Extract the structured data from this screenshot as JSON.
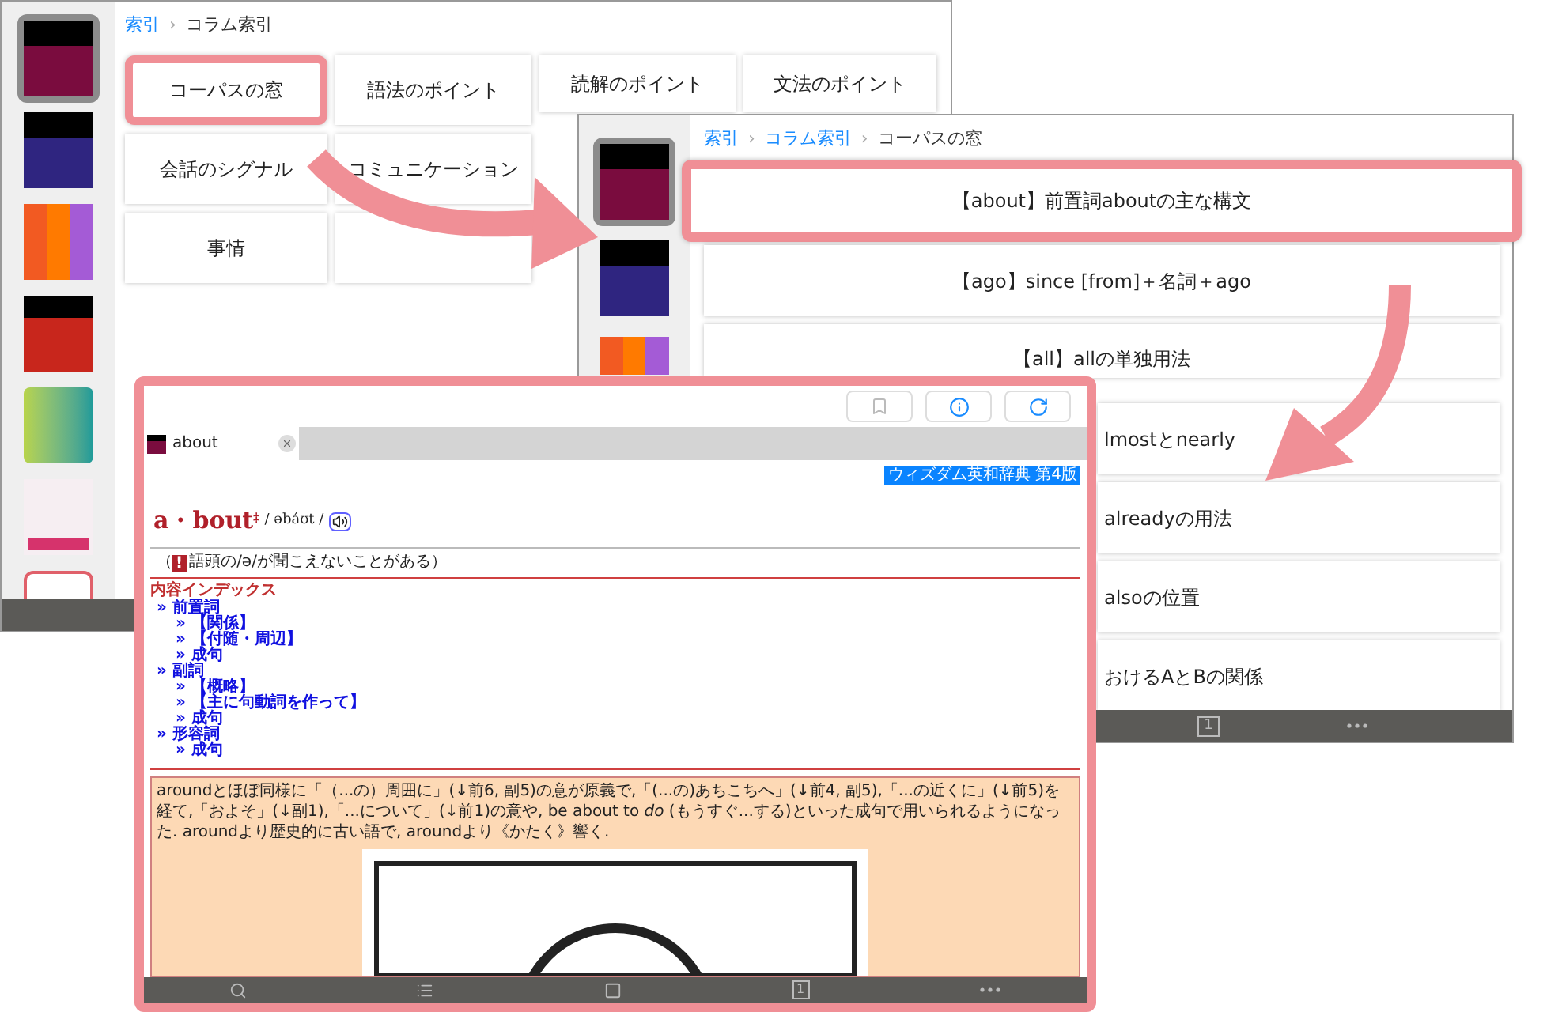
{
  "index_window": {
    "books": [
      {
        "kind": "wisdom-ej",
        "selected": true
      },
      {
        "kind": "wisdom-je",
        "selected": false
      },
      {
        "kind": "daijirin",
        "selected": false
      },
      {
        "kind": "shinmeikai",
        "selected": false
      },
      {
        "kind": "kanjikai",
        "selected": false
      },
      {
        "kind": "kogo",
        "selected": false
      },
      {
        "kind": "ace",
        "selected": false
      }
    ],
    "breadcrumb": {
      "separator": "›",
      "items": [
        "索引",
        "コラム索引"
      ]
    },
    "tiles": [
      {
        "label": "コーパスの窓",
        "kind": "full",
        "highlighted": true
      },
      {
        "label": "語法のポイント",
        "kind": "full",
        "highlighted": false
      },
      {
        "label": "読解のポイント",
        "kind": "cut",
        "highlighted": false
      },
      {
        "label": "文法のポイント",
        "kind": "cut",
        "highlighted": false
      },
      {
        "label": "会話のシグナル",
        "kind": "full",
        "highlighted": false
      },
      {
        "label": "コミュニケーション",
        "kind": "full",
        "highlighted": false
      },
      {
        "label": "事情",
        "kind": "full",
        "highlighted": false
      }
    ]
  },
  "column_window": {
    "books": [
      {
        "kind": "wisdom-ej",
        "selected": true
      },
      {
        "kind": "wisdom-je",
        "selected": false
      },
      {
        "kind": "daijirin",
        "selected": false
      }
    ],
    "breadcrumb": {
      "separator": "›",
      "items": [
        "索引",
        "コラム索引",
        "コーパスの窓"
      ]
    },
    "rows": [
      {
        "label": "【about】前置詞aboutの主な構文",
        "kind": "full",
        "highlighted": true
      },
      {
        "label": "【ago】since [from]＋名詞＋ago",
        "kind": "full",
        "highlighted": false
      },
      {
        "label": "【all】allの単独用法",
        "kind": "cut",
        "highlighted": false
      },
      {
        "label": "lmostとnearly",
        "kind": "clipped",
        "highlighted": false
      },
      {
        "label": "alreadyの用法",
        "kind": "clipped",
        "highlighted": false
      },
      {
        "label": "alsoの位置",
        "kind": "clipped",
        "highlighted": false
      },
      {
        "label": "おけるAとBの関係",
        "kind": "clipped",
        "highlighted": false
      }
    ],
    "tab_count": "1"
  },
  "entry_window": {
    "toolbar": [
      {
        "kind": "bookmark"
      },
      {
        "kind": "info"
      },
      {
        "kind": "refresh"
      }
    ],
    "tabs": [
      {
        "label": "about",
        "selected": true
      }
    ],
    "source_badge": "ウィズダム英和辞典 第4版",
    "headword": "a・bout",
    "headword_mark": "‡",
    "pronunciation": "/ əbáʊt /",
    "note": {
      "open": "（",
      "mark": "!",
      "text": "語頭の/ə/が聞こえないことがある）"
    },
    "index_title": "内容インデックス",
    "index": {
      "bullet": "»",
      "items": [
        {
          "label": "前置詞",
          "children": [
            {
              "label": "【関係】"
            },
            {
              "label": "【付随・周辺】"
            },
            {
              "label": "成句"
            }
          ]
        },
        {
          "label": "副詞",
          "children": [
            {
              "label": "【概略】"
            },
            {
              "label": "【主に句動詞を作って】"
            },
            {
              "label": "成句"
            }
          ]
        },
        {
          "label": "形容詞",
          "children": [
            {
              "label": "成句"
            }
          ]
        }
      ]
    },
    "etymology": "aroundとほぼ同様に「（...の）周囲に」(↓前6, 副5)の意が原義で,「(...の)あちこちへ」(↓前4, 副5),「...の近くに」(↓前5)を経て,「およそ」(↓副1),「...について」(↓前1)の意や, be about to *do* (もうすぐ...する)といった成句で用いられるようになった. aroundより歴史的に古い語で, aroundより《かたく》響く.",
    "tab_count": "1"
  }
}
